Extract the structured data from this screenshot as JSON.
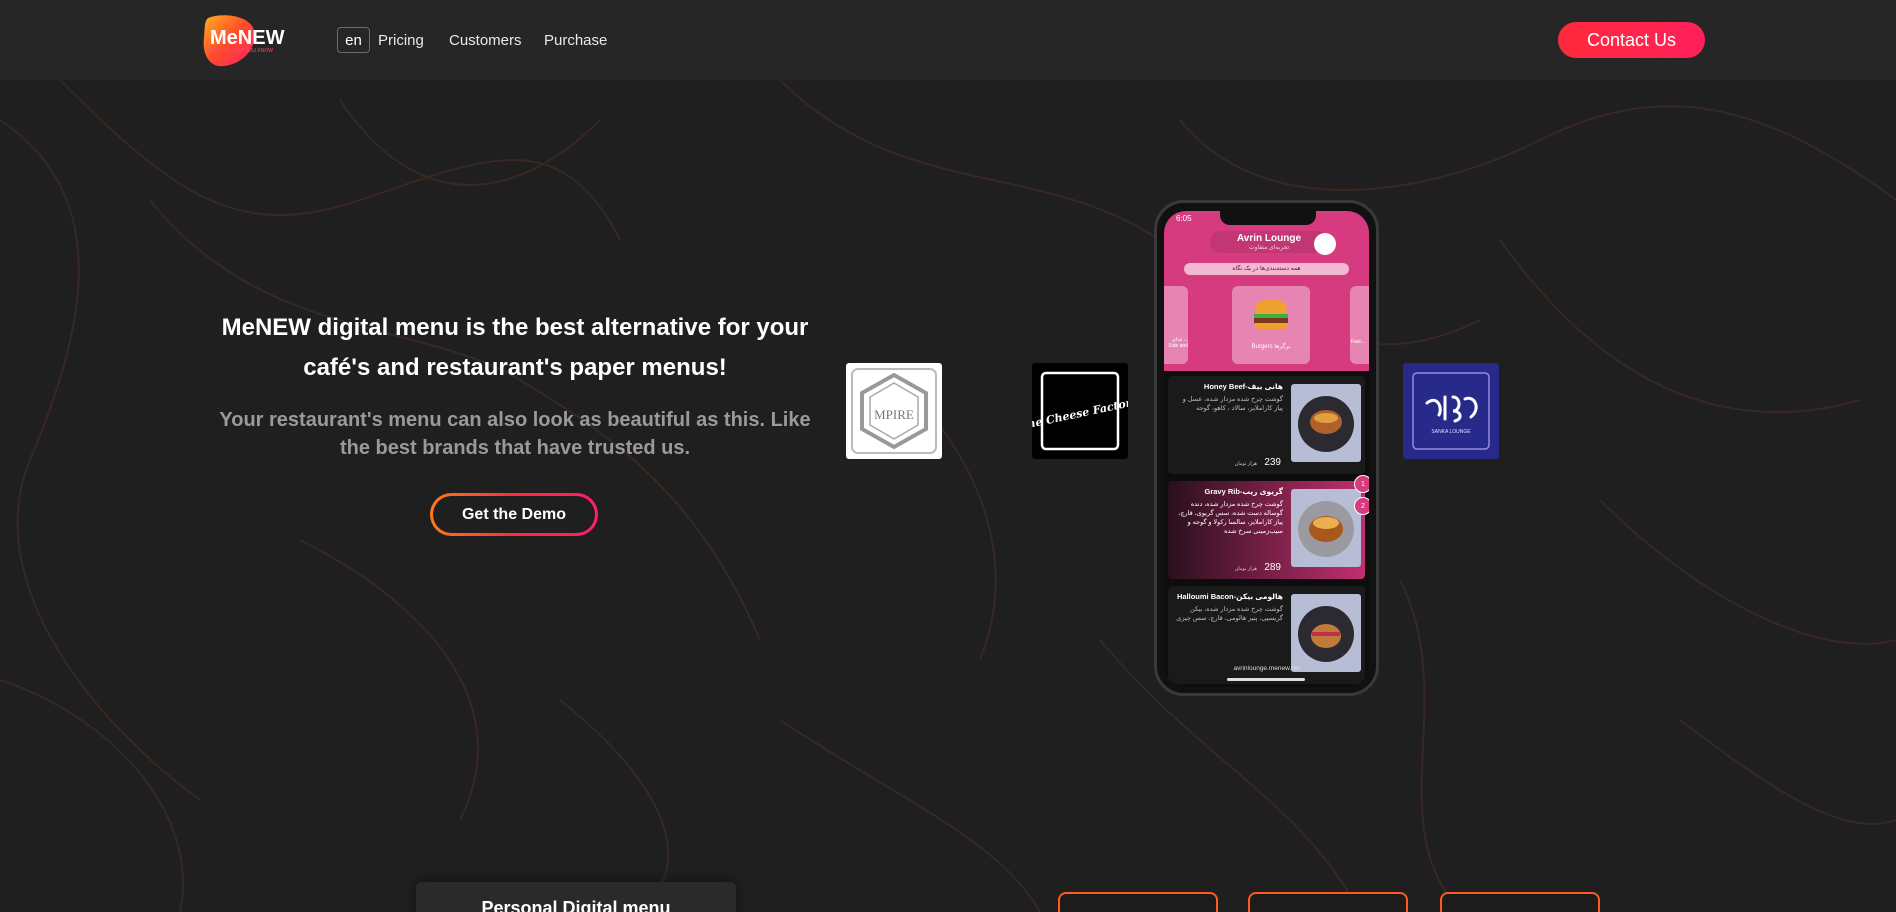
{
  "brand": {
    "logo_text": "MeNEW",
    "logo_tagline": "NOT THE WAY YOU KNOW",
    "accent_color": "#ff2b3c",
    "gradient": [
      "#ff7a18",
      "#ff2b3c",
      "#ff1f6a"
    ]
  },
  "header": {
    "lang": "en",
    "nav": [
      "Pricing",
      "Customers",
      "Purchase"
    ],
    "contact_label": "Contact Us"
  },
  "hero": {
    "title": "MeNEW digital menu is the best alternative for your café's and restaurant's paper menus!",
    "subtitle": "Your restaurant's menu can also look as beautiful as this. Like the best brands that have trusted us.",
    "demo_label": "Get the Demo"
  },
  "brands": [
    {
      "name": "Empire",
      "logo_text": "MPIRE",
      "icon": "hexagon-logo"
    },
    {
      "name": "The Cheese Factory",
      "logo_text": "the Cheese Factory",
      "icon": "cheese-factory-logo"
    },
    {
      "name": "Sanka Lounge",
      "logo_text": "SANKA LOUNGE",
      "icon": "sanka-logo"
    }
  ],
  "phone": {
    "time": "6:05",
    "venue_name": "Avrin Lounge",
    "venue_tagline": "تجربه‌ای متفاوت",
    "category_strip": "همه دسته‌بندی‌ها در یک نگاه",
    "category_active": "Burgers برگرها",
    "category_left": "غذای ... Side and",
    "category_right": "Fast...",
    "items": [
      {
        "title": "Honey Beef-هانی بیف",
        "desc": "گوشت چرخ شده مزدار شده، عسل و پیاز کاراملایز، سالاد ، کاهو، گوجه",
        "price": "239",
        "currency": "هزار تومان"
      },
      {
        "title": "Gravy Rib-گریوی ریب",
        "desc": "گوشت چرخ شده مزدار شده، دنده گوساله دست شده، سس گریوی، قارچ، پیاز کاراملایز، سالسا رکولا و گوجه و سیب‌زمینی سرخ شده",
        "price": "289",
        "currency": "هزار تومان"
      },
      {
        "title": "Halloumi Bacon-هالومی بیکن",
        "desc": "گوشت چرخ شده مزدار شده، بیکن گریسپی، پنیر هالومی، قارچ، سس چیزی",
        "price": "",
        "currency": ""
      }
    ],
    "badges": [
      "1",
      "2"
    ],
    "url": "avrinlounge.menew.pw"
  },
  "bottom": {
    "feature_title": "Personal Digital menu"
  }
}
